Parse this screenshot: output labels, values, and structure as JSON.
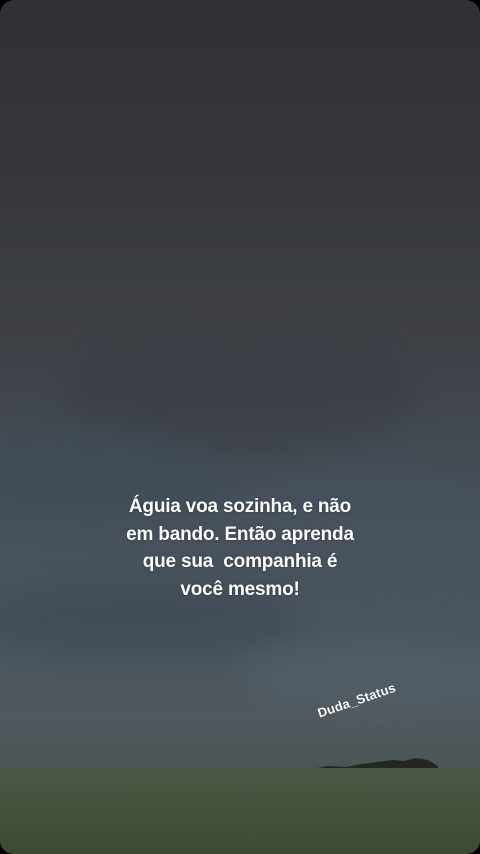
{
  "quote": {
    "lines": [
      "Águia voa sozinha, e não",
      "em bando. Então aprenda",
      "que sua  companhia é",
      "você mesmo!"
    ]
  },
  "watermark": {
    "text": "Duda_Status"
  },
  "colors": {
    "sky_top": "#2f3135",
    "sky_bottom": "#50595f",
    "field": "#46523b",
    "text": "#ffffff"
  }
}
